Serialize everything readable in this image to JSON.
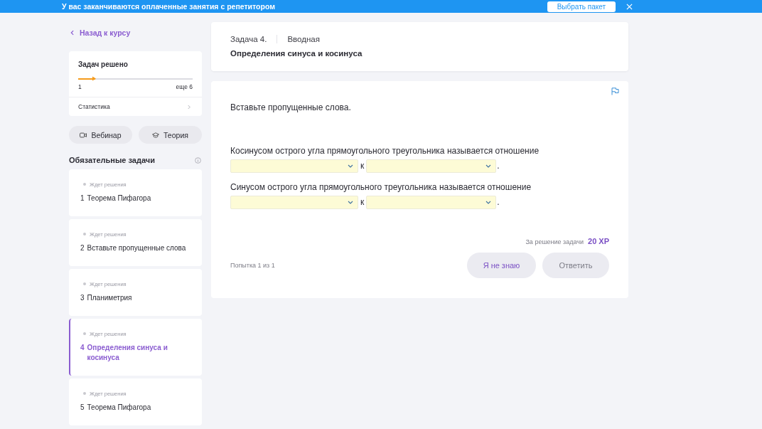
{
  "banner": {
    "text": "У вас заканчиваются оплаченные занятия с репетитором",
    "button": "Выбрать пакет"
  },
  "sidebar": {
    "back_link": "Назад к курсу",
    "stats": {
      "title": "Задач решено",
      "level": 0.15,
      "solved": "1",
      "remaining": "еще 6",
      "link": "Статистика"
    },
    "buttons": [
      {
        "kind": "webinar",
        "label": "Вебинар"
      },
      {
        "kind": "theory",
        "label": "Теория"
      }
    ],
    "section_title": "Обязательные задачи",
    "tasks": [
      {
        "status": "Ждет решения",
        "number": "1",
        "title": "Теорема Пифагора",
        "selected": false
      },
      {
        "status": "Ждет решения",
        "number": "2",
        "title": "Вставьте пропущенные слова",
        "selected": false
      },
      {
        "status": "Ждет решения",
        "number": "3",
        "title": "Планиметрия",
        "selected": false
      },
      {
        "status": "Ждет решения",
        "number": "4",
        "title": "Определения синуса и косинуса",
        "selected": true
      },
      {
        "status": "Ждет решения",
        "number": "5",
        "title": "Теорема Пифагора",
        "selected": false
      }
    ]
  },
  "task_header": {
    "number": "Задача 4.",
    "type": "Вводная",
    "title": "Определения синуса и косинуса"
  },
  "task": {
    "instruction": "Вставьте пропущенные слова.",
    "sentences": [
      {
        "text": "Косинусом острого угла прямоугольного треугольника называется отношение",
        "parts": [
          {
            "kind": "dropdown"
          },
          {
            "kind": "text",
            "text": "к"
          },
          {
            "kind": "dropdown"
          },
          {
            "kind": "text",
            "text": "."
          }
        ]
      },
      {
        "text": "Синусом острого угла прямоугольного треугольника называется отношение",
        "parts": [
          {
            "kind": "dropdown"
          },
          {
            "kind": "text",
            "text": "к"
          },
          {
            "kind": "dropdown"
          },
          {
            "kind": "text",
            "text": "."
          }
        ]
      }
    ],
    "reward_label": "За решение задачи",
    "reward": "20 XP",
    "attempts": "Попытка 1 из 1",
    "buttons": [
      {
        "label": "Я не знаю",
        "disabled": false
      },
      {
        "label": "Ответить",
        "disabled": true
      }
    ]
  }
}
